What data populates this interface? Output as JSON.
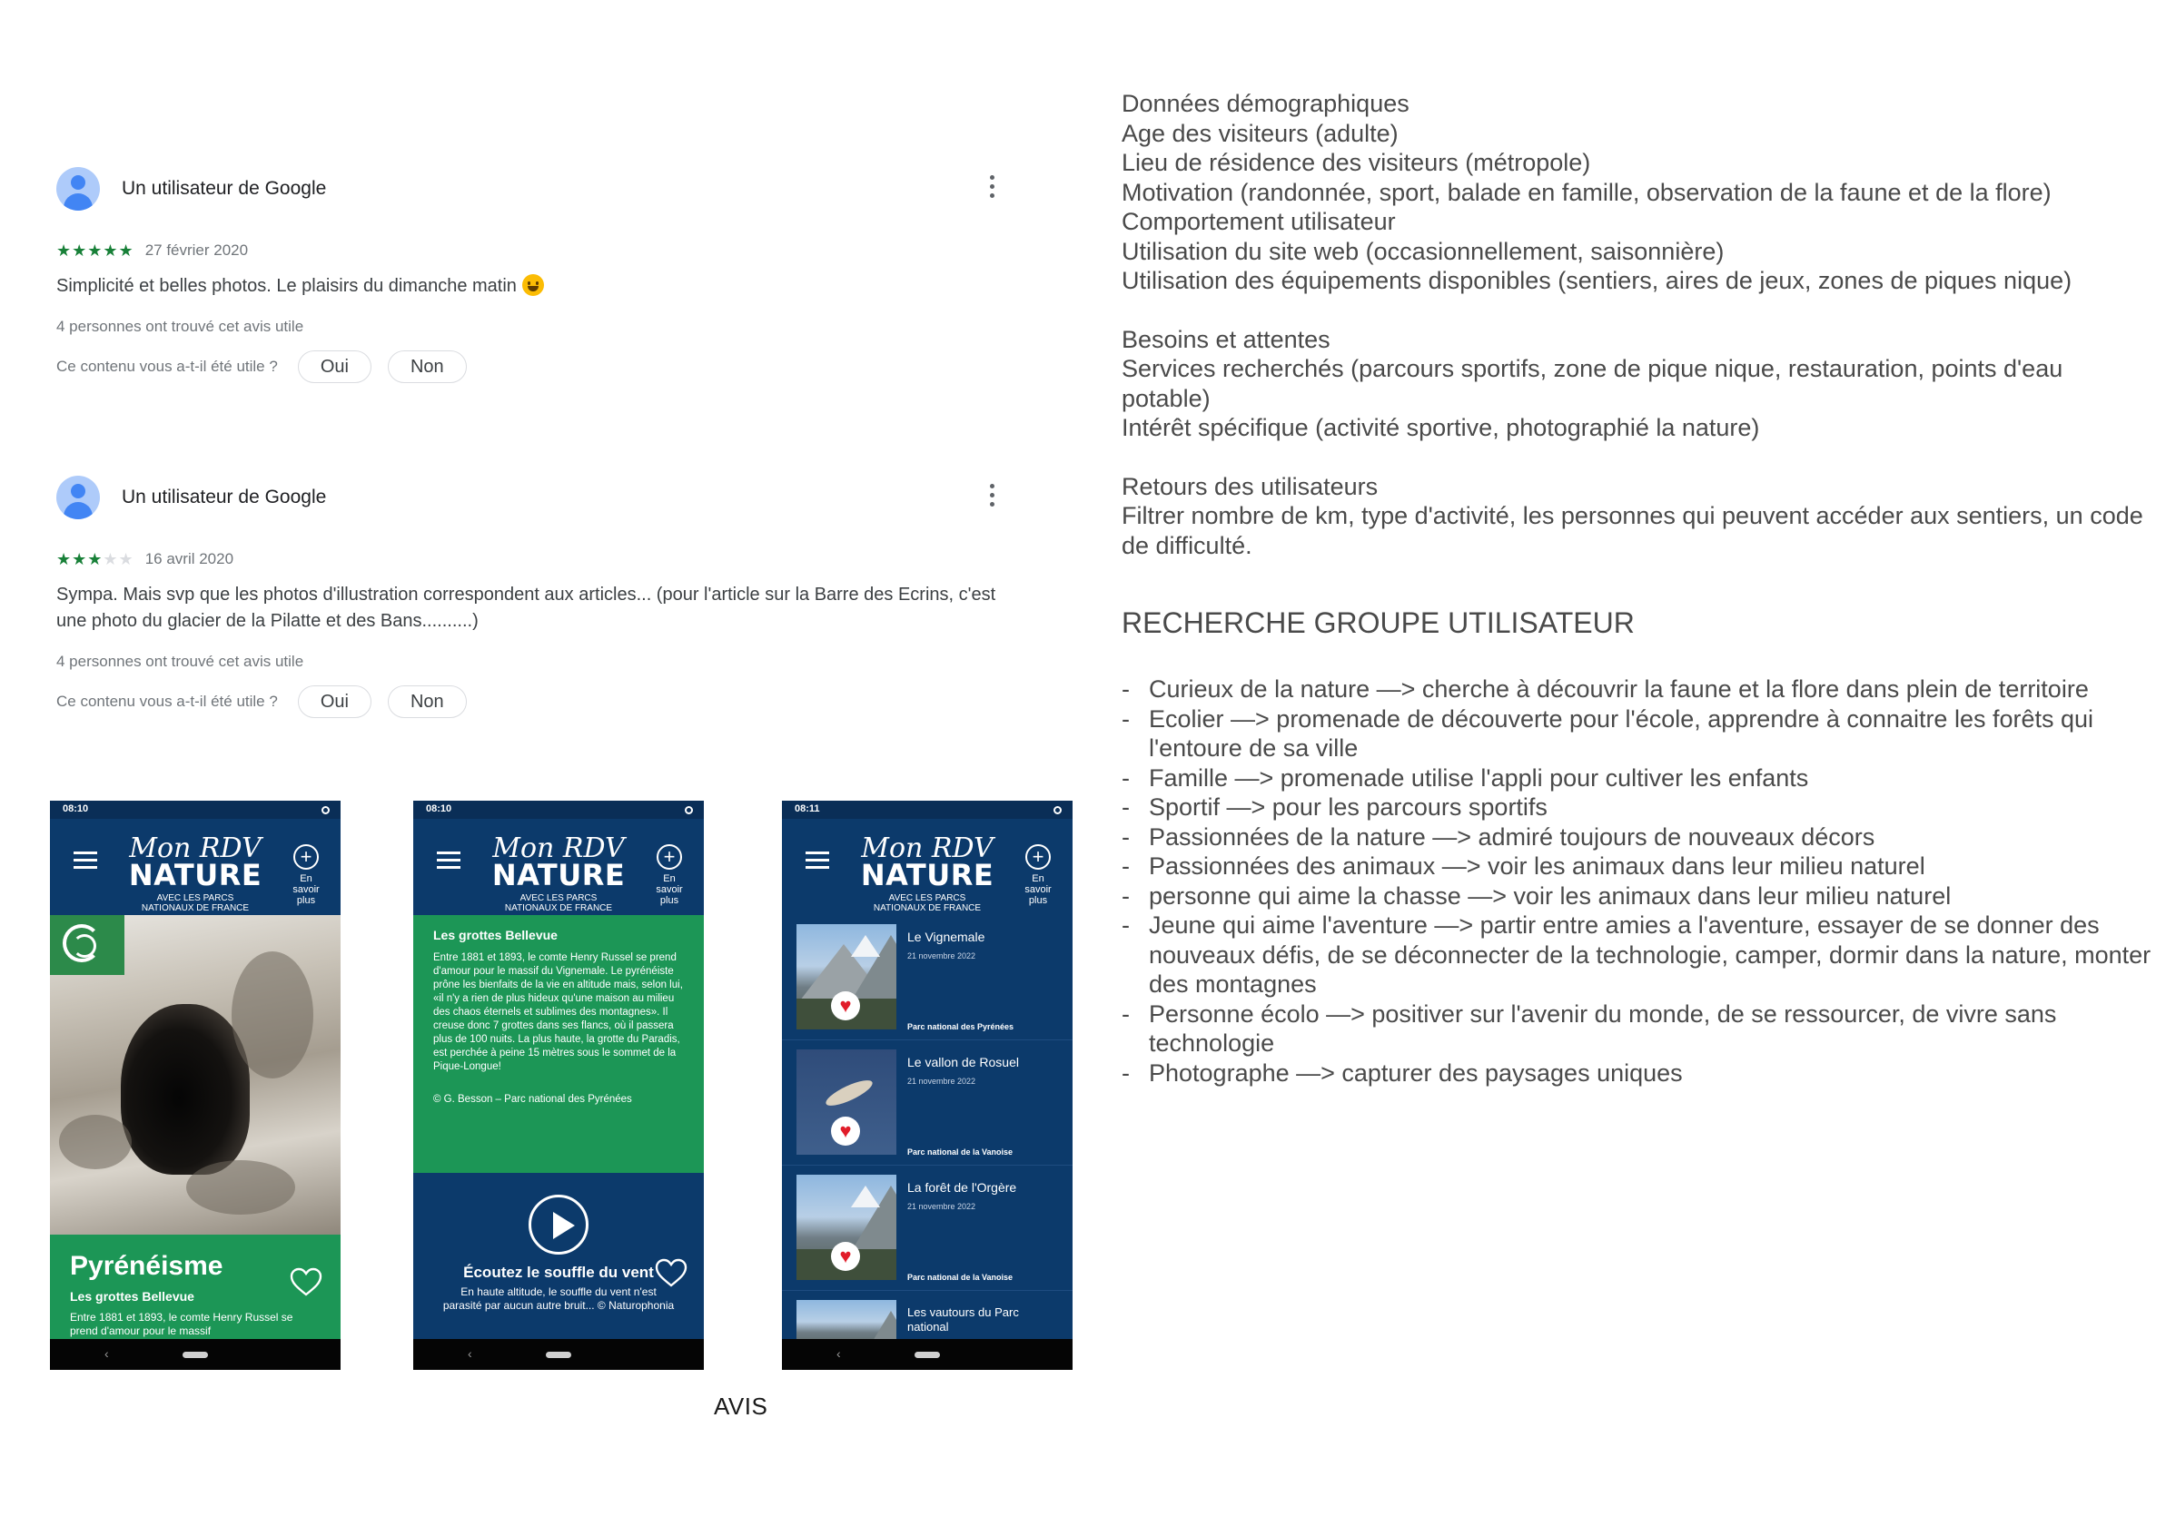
{
  "reviews": [
    {
      "user": "Un utilisateur de Google",
      "stars_on": "★★★★★",
      "stars_off": "",
      "rating": 5,
      "date": "27 février 2020",
      "text": "Simplicité et belles photos. Le plaisirs du dimanche matin",
      "helpful": "4 personnes ont trouvé cet avis utile",
      "question": "Ce contenu vous a-t-il été utile ?",
      "yes": "Oui",
      "no": "Non"
    },
    {
      "user": "Un utilisateur de Google",
      "stars_on": "★★★",
      "stars_off": "★★",
      "rating": 3,
      "date": "16 avril 2020",
      "text": "Sympa. Mais svp que les photos d'illustration correspondent aux articles... (pour l'article sur la Barre des Ecrins, c'est une photo du glacier de la Pilatte et des Bans..........)",
      "helpful": "4 personnes ont trouvé cet avis utile",
      "question": "Ce contenu vous a-t-il été utile ?",
      "yes": "Oui",
      "no": "Non"
    }
  ],
  "app": {
    "logo_script": "Mon RDV",
    "logo_main": "NATURE",
    "logo_sub_1": "AVEC LES PARCS",
    "logo_sub_2": "NATIONAUX DE FRANCE",
    "plus_label": "En savoir plus"
  },
  "phones": {
    "p1": {
      "time": "08:10",
      "title": "Pyrénéisme",
      "subtitle": "Les grottes Bellevue",
      "body": "Entre 1881 et 1893, le comte Henry Russel se prend d'amour pour le massif"
    },
    "p2": {
      "time": "08:10",
      "title": "Les grottes Bellevue",
      "body": "Entre 1881 et 1893, le comte Henry Russel se prend d'amour pour le massif du Vignemale. Le pyrénéiste prône les bienfaits de la vie en altitude mais, selon lui, «il n'y a rien de plus hideux qu'une maison au milieu des chaos éternels et sublimes des montagnes». Il creuse donc 7 grottes dans ses flancs, où il passera plus de 100 nuits. La plus haute, la grotte du Paradis, est perchée à peine 15 mètres sous le sommet de la Pique-Longue!",
      "credit": "© G. Besson – Parc national des Pyrénées",
      "audio_title": "Écoutez le souffle du vent",
      "audio_body": "En haute altitude, le souffle du vent n'est parasité par aucun autre bruit... © Naturophonia"
    },
    "p3": {
      "time": "08:11",
      "items": [
        {
          "title": "Le Vignemale",
          "date": "21 novembre 2022",
          "park": "Parc national des Pyrénées"
        },
        {
          "title": "Le vallon de Rosuel",
          "date": "21 novembre 2022",
          "park": "Parc national de la Vanoise"
        },
        {
          "title": "La forêt de l'Orgère",
          "date": "21 novembre 2022",
          "park": "Parc national de la Vanoise"
        },
        {
          "title": "Les vautours du Parc national",
          "date": "",
          "park": ""
        }
      ]
    }
  },
  "caption": "AVIS",
  "notes": {
    "demo_title": "Données démographiques",
    "demo_lines": [
      "Age des visiteurs (adulte)",
      "Lieu de résidence des visiteurs (métropole)",
      "Motivation (randonnée, sport, balade en famille, observation de la faune et de la flore)",
      "Comportement utilisateur",
      "Utilisation du site web (occasionnellement, saisonnière)",
      "Utilisation des équipements disponibles (sentiers, aires de jeux, zones de piques nique)"
    ],
    "needs_title": "Besoins et attentes",
    "needs_lines": [
      "Services recherchés (parcours sportifs, zone de pique nique, restauration, points d'eau potable)",
      "Intérêt spécifique (activité sportive, photographié la nature)"
    ],
    "feedback_title": "Retours des utilisateurs",
    "feedback_line": "Filtrer nombre de km, type d'activité, les personnes qui peuvent accéder aux sentiers, un code de difficulté.",
    "group_title": "RECHERCHE GROUPE UTILISATEUR",
    "groups": [
      "Curieux de la nature —> cherche à découvrir la faune et la flore dans plein de territoire",
      "Ecolier —> promenade de découverte pour l'école, apprendre à connaitre les forêts qui l'entoure de sa ville",
      "Famille —> promenade utilise l'appli pour cultiver les enfants",
      "Sportif —> pour les parcours sportifs",
      "Passionnées de la nature —> admiré toujours de nouveaux décors",
      "Passionnées des animaux —> voir les animaux dans leur milieu naturel",
      "personne qui aime la chasse —> voir les animaux dans leur milieu naturel",
      "Jeune qui aime l'aventure —> partir entre amies a l'aventure, essayer de se donner des nouveaux défis, de se déconnecter de la technologie, camper, dormir dans la nature, monter des montagnes",
      "Personne écolo —> positiver sur l'avenir du monde, de se ressourcer, de vivre sans technologie",
      "Photographe —> capturer des paysages uniques"
    ]
  },
  "colors": {
    "app_blue": "#0c3a6b",
    "app_green": "#1c9656",
    "star_green": "#188038",
    "avatar_blue": "#4285f4"
  }
}
